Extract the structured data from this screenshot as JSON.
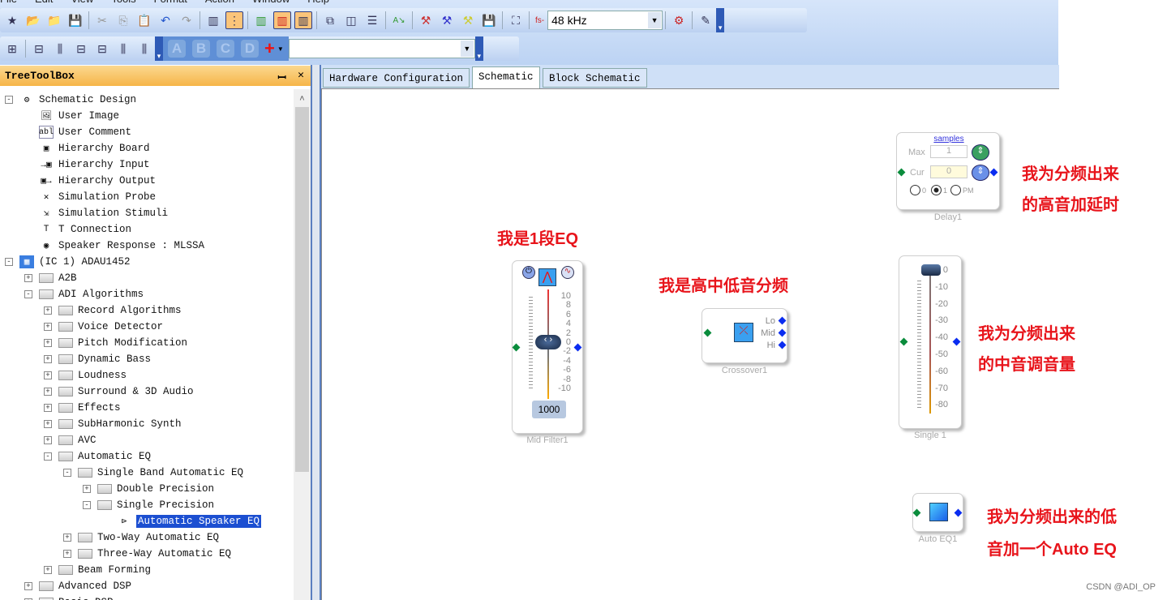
{
  "menu": [
    "File",
    "Edit",
    "View",
    "Tools",
    "Format",
    "Action",
    "Window",
    "Help"
  ],
  "toolbar": {
    "sample_rate": "48 kHz",
    "sample_rate_prefix": "fs-",
    "letters": [
      "A",
      "B",
      "C",
      "D"
    ],
    "add": "+",
    "combo_value": ""
  },
  "panel": {
    "title": "TreeToolBox",
    "pin": "📌",
    "close": "✕"
  },
  "tree": [
    {
      "label": "Schematic Design",
      "level": 0,
      "toggle": "-",
      "icon": "schematic-icon"
    },
    {
      "label": "User Image",
      "level": 1,
      "icon": "image-icon"
    },
    {
      "label": "User Comment",
      "level": 1,
      "icon": "comment-icon",
      "icon_text": "abl"
    },
    {
      "label": "Hierarchy Board",
      "level": 1,
      "icon": "hierarchy-board-icon"
    },
    {
      "label": "Hierarchy Input",
      "level": 1,
      "icon": "hierarchy-input-icon"
    },
    {
      "label": "Hierarchy Output",
      "level": 1,
      "icon": "hierarchy-output-icon"
    },
    {
      "label": "Simulation Probe",
      "level": 1,
      "icon": "probe-icon"
    },
    {
      "label": "Simulation Stimuli",
      "level": 1,
      "icon": "stimuli-icon"
    },
    {
      "label": "T Connection",
      "level": 1,
      "icon": "t-connection-icon"
    },
    {
      "label": "Speaker Response : MLSSA",
      "level": 1,
      "icon": "speaker-icon"
    },
    {
      "label": "(IC 1) ADAU1452",
      "level": 0,
      "toggle": "-",
      "icon": "chip-icon"
    },
    {
      "label": "A2B",
      "level": 1,
      "toggle": "+",
      "icon": "folder-icon"
    },
    {
      "label": "ADI Algorithms",
      "level": 1,
      "toggle": "-",
      "icon": "folder-icon"
    },
    {
      "label": "Record Algorithms",
      "level": 2,
      "toggle": "+",
      "icon": "folder-icon"
    },
    {
      "label": "Voice Detector",
      "level": 2,
      "toggle": "+",
      "icon": "folder-icon"
    },
    {
      "label": "Pitch Modification",
      "level": 2,
      "toggle": "+",
      "icon": "folder-icon"
    },
    {
      "label": "Dynamic Bass",
      "level": 2,
      "toggle": "+",
      "icon": "folder-icon"
    },
    {
      "label": "Loudness",
      "level": 2,
      "toggle": "+",
      "icon": "folder-icon"
    },
    {
      "label": "Surround & 3D Audio",
      "level": 2,
      "toggle": "+",
      "icon": "folder-icon"
    },
    {
      "label": "Effects",
      "level": 2,
      "toggle": "+",
      "icon": "folder-icon"
    },
    {
      "label": "SubHarmonic Synth",
      "level": 2,
      "toggle": "+",
      "icon": "folder-icon"
    },
    {
      "label": "AVC",
      "level": 2,
      "toggle": "+",
      "icon": "folder-icon"
    },
    {
      "label": "Automatic EQ",
      "level": 2,
      "toggle": "-",
      "icon": "folder-icon"
    },
    {
      "label": "Single Band Automatic EQ",
      "level": 3,
      "toggle": "-",
      "icon": "folder-icon"
    },
    {
      "label": "Double Precision",
      "level": 4,
      "toggle": "+",
      "icon": "folder-icon"
    },
    {
      "label": "Single Precision",
      "level": 4,
      "toggle": "-",
      "icon": "folder-icon"
    },
    {
      "label": "Automatic Speaker EQ",
      "level": 5,
      "icon": "speaker-eq-icon",
      "selected": true
    },
    {
      "label": "Two-Way Automatic EQ",
      "level": 3,
      "toggle": "+",
      "icon": "folder-icon"
    },
    {
      "label": "Three-Way Automatic EQ",
      "level": 3,
      "toggle": "+",
      "icon": "folder-icon"
    },
    {
      "label": "Beam Forming",
      "level": 2,
      "toggle": "+",
      "icon": "folder-icon"
    },
    {
      "label": "Advanced DSP",
      "level": 1,
      "toggle": "+",
      "icon": "folder-icon"
    },
    {
      "label": "Basic DSP",
      "level": 1,
      "toggle": "+",
      "icon": "folder-icon"
    }
  ],
  "tabs": [
    {
      "label": "Hardware Configuration"
    },
    {
      "label": "Schematic",
      "active": true
    },
    {
      "label": "Block Schematic"
    }
  ],
  "blocks": {
    "mid_filter": {
      "name": "Mid Filter1",
      "value": "1000",
      "ticks": [
        "10",
        "8",
        "6",
        "4",
        "2",
        "0",
        "-2",
        "-4",
        "-6",
        "-8",
        "-10"
      ],
      "gain_db": 0
    },
    "crossover": {
      "name": "Crossover1",
      "outputs": [
        "Lo",
        "Mid",
        "Hi"
      ]
    },
    "delay": {
      "name": "Delay1",
      "unit": "samples",
      "max_label": "Max",
      "max_value": "1",
      "cur_label": "Cur",
      "cur_value": "0",
      "radios": [
        "0",
        "1",
        "PM"
      ],
      "selected_radio": "1"
    },
    "single": {
      "name": "Single 1",
      "ticks": [
        "0",
        "-10",
        "-20",
        "-30",
        "-40",
        "-50",
        "-60",
        "-70",
        "-80"
      ],
      "gain_db": 0
    },
    "auto_eq": {
      "name": "Auto EQ1"
    }
  },
  "notes": {
    "eq": "我是1段EQ",
    "crossover": "我是高中低音分频",
    "delay": [
      "我为分频出来",
      "的高音加延时"
    ],
    "volume": [
      "我为分频出来",
      "的中音调音量"
    ],
    "auto_eq": [
      "我为分频出来的低",
      "音加一个Auto EQ"
    ]
  },
  "watermark": "CSDN @ADI_OP",
  "colors": {
    "note": "#e8141b",
    "selection": "#1c4fd1",
    "panel_header": "#f6b549",
    "toolbar": "#c4d8f5"
  }
}
